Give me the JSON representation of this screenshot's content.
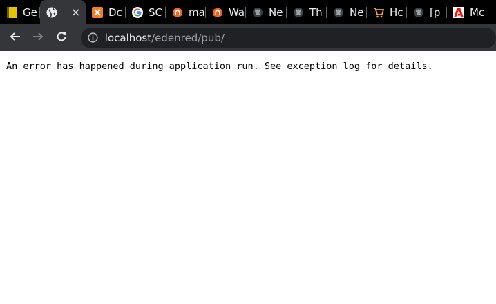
{
  "tabs": [
    {
      "title": "Ge",
      "icon": "yellow-doc-icon",
      "color": "#e5c400"
    },
    {
      "title": "",
      "icon": "globe-icon",
      "active": true,
      "close": "×"
    },
    {
      "title": "Dc",
      "icon": "xampp-icon",
      "color": "#fb7a24"
    },
    {
      "title": "SC",
      "icon": "google-icon"
    },
    {
      "title": "ma",
      "icon": "magento-icon",
      "color": "#f26322"
    },
    {
      "title": "Wa",
      "icon": "magento-icon",
      "color": "#f26322"
    },
    {
      "title": "Ne",
      "icon": "github-icon"
    },
    {
      "title": "Th",
      "icon": "github-icon"
    },
    {
      "title": "Ne",
      "icon": "github-icon"
    },
    {
      "title": "Hc",
      "icon": "cart-icon",
      "color": "#f5a623"
    },
    {
      "title": "[p",
      "icon": "github-icon"
    },
    {
      "title": "Mc",
      "icon": "adobe-icon",
      "color": "#fa0f00"
    }
  ],
  "address": {
    "host": "localhost",
    "path": "/edenred/pub/"
  },
  "page": {
    "error_text": "An error has happened during application run. See exception log for details."
  }
}
